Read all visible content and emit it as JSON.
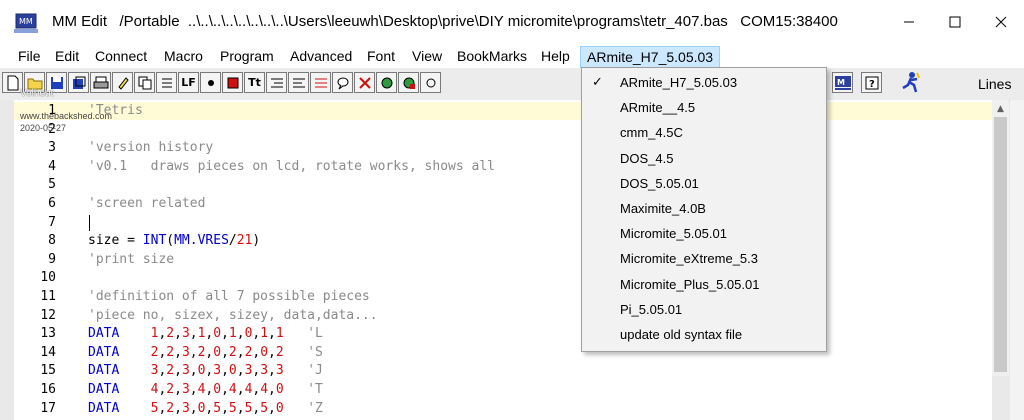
{
  "window": {
    "title": "MM Edit   /Portable  ..\\..\\..\\..\\..\\..\\..\\..\\Users\\leeuwh\\Desktop\\prive\\DIY micromite\\programs\\tetr_407.bas   COM15:38400",
    "minimize_icon": "minimize-icon",
    "maximize_icon": "maximize-icon",
    "close_icon": "close-icon"
  },
  "menubar": {
    "items": [
      "File",
      "Edit",
      "Connect",
      "Macro",
      "Program",
      "Advanced",
      "Font",
      "View",
      "BookMarks",
      "Help",
      "ARmite_H7_5.05.03"
    ]
  },
  "toolbar": {
    "lf_label": "LF",
    "tt_label": "Tt",
    "lines_label": "Lines"
  },
  "watermark": {
    "line1": "Volhout",
    "line2": "www.thebackshed.com",
    "line3": "2020-05-27"
  },
  "editor": {
    "lines": [
      {
        "n": "1",
        "t": "'Tetris"
      },
      {
        "n": "2",
        "t": ""
      },
      {
        "n": "3",
        "t": "'version history"
      },
      {
        "n": "4",
        "t": "'v0.1   draws pieces on lcd, rotate works, shows all"
      },
      {
        "n": "5",
        "t": ""
      },
      {
        "n": "6",
        "t": "'screen related"
      },
      {
        "n": "7",
        "t": ""
      },
      {
        "n": "8",
        "t": "size = INT(MM.VRES/21)"
      },
      {
        "n": "9",
        "t": "'print size"
      },
      {
        "n": "10",
        "t": ""
      },
      {
        "n": "11",
        "t": "'definition of all 7 possible pieces"
      },
      {
        "n": "12",
        "t": "'piece no, sizex, sizey, data,data..."
      },
      {
        "n": "13",
        "t": "DATA    1,2,3,1,0,1,0,1,1   'L"
      },
      {
        "n": "14",
        "t": "DATA    2,2,3,2,0,2,2,0,2   'S"
      },
      {
        "n": "15",
        "t": "DATA    3,2,3,0,3,0,3,3,3   'J"
      },
      {
        "n": "16",
        "t": "DATA    4,2,3,4,0,4,4,4,0   'T"
      },
      {
        "n": "17",
        "t": "DATA    5,2,3,0,5,5,5,5,0   'Z"
      }
    ]
  },
  "dropdown": {
    "items": [
      {
        "label": "ARmite_H7_5.05.03",
        "checked": true
      },
      {
        "label": "ARmite__4.5",
        "checked": false
      },
      {
        "label": "cmm_4.5C",
        "checked": false
      },
      {
        "label": "DOS_4.5",
        "checked": false
      },
      {
        "label": "DOS_5.05.01",
        "checked": false
      },
      {
        "label": "Maximite_4.0B",
        "checked": false
      },
      {
        "label": "Micromite_5.05.01",
        "checked": false
      },
      {
        "label": "Micromite_eXtreme_5.3",
        "checked": false
      },
      {
        "label": "Micromite_Plus_5.05.01",
        "checked": false
      },
      {
        "label": "Pi_5.05.01",
        "checked": false
      },
      {
        "label": "update old syntax file",
        "checked": false
      }
    ],
    "check_glyph": "✓"
  },
  "colors": {
    "keyword": "#0000cc",
    "number": "#d01010",
    "comment": "#8a8a8a",
    "menu_highlight": "#cce8ff",
    "dropdown_hover": "#91c9f7"
  }
}
